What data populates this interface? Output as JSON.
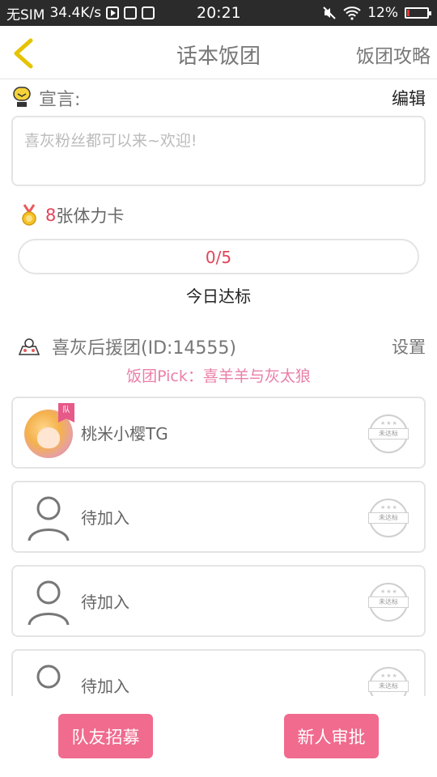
{
  "status_bar": {
    "carrier": "无SIM",
    "speed": "34.4K/s",
    "time": "20:21",
    "battery": "12%",
    "battery_level": 0.12,
    "battery_color": "#e53935"
  },
  "header": {
    "title": "话本饭团",
    "right_link": "饭团攻略",
    "back_icon": "chevron-left-icon",
    "accent": "#e6c300"
  },
  "declaration": {
    "label": "宣言:",
    "edit_label": "编辑",
    "placeholder": "喜灰粉丝都可以来~欢迎!"
  },
  "stamina": {
    "count": "8",
    "label": "张体力卡",
    "progress_text": "0/5",
    "progress_value": 0,
    "daily_label": "今日达标"
  },
  "group": {
    "name": "喜灰后援团(ID:14555)",
    "settings_label": "设置",
    "pick": "饭团Pick：喜羊羊与灰太狼"
  },
  "members": [
    {
      "name": "桃米小樱TG",
      "is_leader": true,
      "badge": "队",
      "stamp": "未达标"
    },
    {
      "name": "待加入",
      "is_leader": false,
      "stamp": "未达标"
    },
    {
      "name": "待加入",
      "is_leader": false,
      "stamp": "未达标"
    },
    {
      "name": "待加入",
      "is_leader": false,
      "stamp": "未达标"
    }
  ],
  "actions": {
    "recruit_label": "队友招募",
    "approve_label": "新人审批",
    "button_color": "#f06b8e"
  }
}
